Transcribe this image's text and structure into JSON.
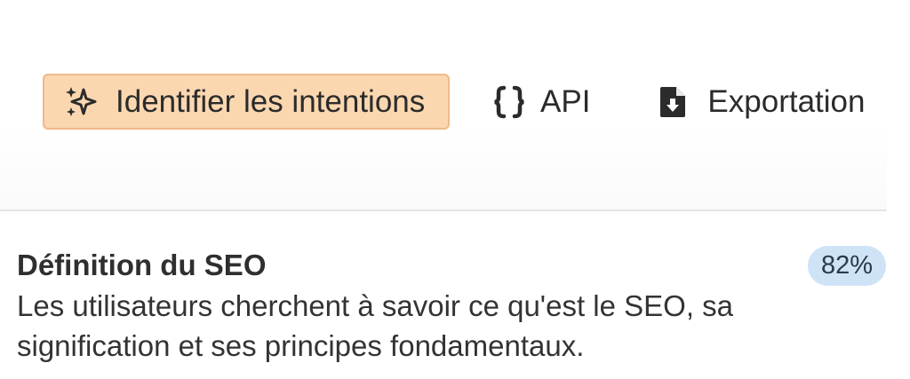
{
  "toolbar": {
    "identify_label": "Identifier les intentions",
    "api_label": "API",
    "export_label": "Exportation",
    "identify_icon": "sparkles-icon",
    "api_icon": "curly-braces-icon",
    "export_icon": "file-download-icon",
    "accent_bg": "#fbd7b0",
    "accent_border": "#efb98a"
  },
  "intent": {
    "title": "Définition du SEO",
    "description": "Les utilisateurs cherchent à savoir ce qu'est le SEO, sa signification et ses principes fondamentaux.",
    "score": "82%",
    "badge_color": "#cfe3f7"
  }
}
